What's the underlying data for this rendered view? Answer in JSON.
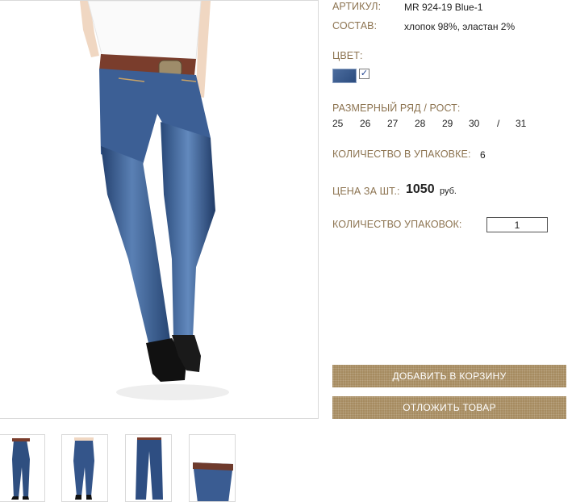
{
  "product": {
    "article_label": "АРТИКУЛ:",
    "article_value": "MR 924-19 Blue-1",
    "composition_label": "СОСТАВ:",
    "composition_value": "хлопок 98%, эластан 2%",
    "color_label": "ЦВЕТ:",
    "color_swatch": "#3a5a8c",
    "color_checked": "✓",
    "sizes_label": "РАЗМЕРНЫЙ РЯД / РОСТ:",
    "sizes": [
      "25",
      "26",
      "27",
      "28",
      "29",
      "30",
      "/",
      "31"
    ],
    "pack_qty_label": "КОЛИЧЕСТВО В УПАКОВКЕ:",
    "pack_qty_value": "6",
    "price_label": "ЦЕНА ЗА ШТ.:",
    "price_value": "1050",
    "price_currency": "руб.",
    "packs_label": "КОЛИЧЕСТВО УПАКОВОК:",
    "packs_value": "1"
  },
  "actions": {
    "add_to_cart": "ДОБАВИТЬ В КОРЗИНУ",
    "postpone": "ОТЛОЖИТЬ ТОВАР"
  },
  "colors": {
    "label": "#8c7350",
    "button": "#a58a5e",
    "denim": "#2f4f80"
  },
  "images": {
    "main": "model-wearing-jeans",
    "thumbnails": [
      "front-view",
      "back-view",
      "flat-jeans",
      "waistband-detail"
    ]
  }
}
